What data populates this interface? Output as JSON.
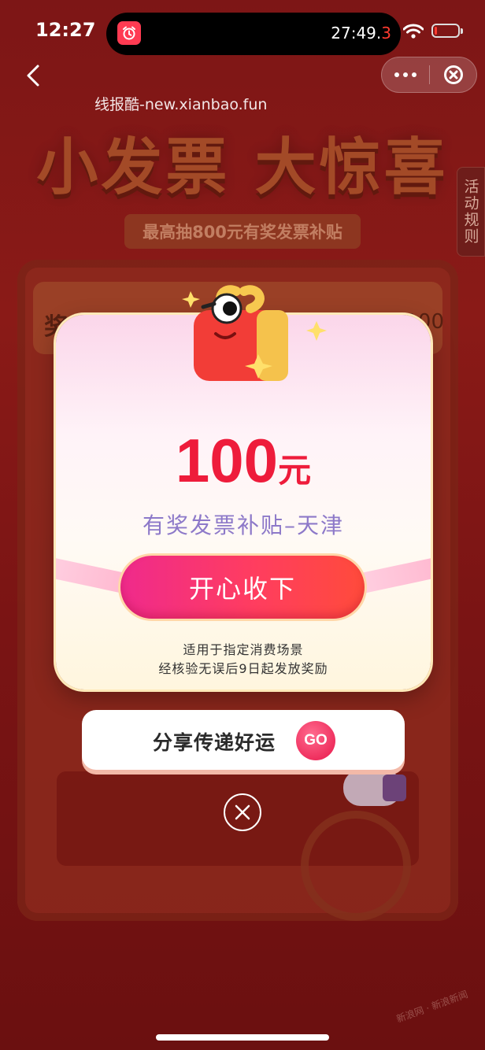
{
  "status_bar": {
    "time": "12:27",
    "timer_main": "27:49.",
    "timer_red": "3",
    "alarm_icon": "alarm-clock-icon",
    "wifi_icon": "wifi-icon",
    "battery_level": 0.12,
    "battery_color": "#ff3b30"
  },
  "nav": {
    "back_icon": "chevron-left-icon",
    "more_icon": "more-dots-icon",
    "close_icon": "close-circle-icon"
  },
  "watermark": "线报酷-new.xianbao.fun",
  "background": {
    "headline": "小发票 大惊喜",
    "subline": "最高抽800元有奖发票补贴",
    "rules_tab": "活动规则",
    "prize_label": "奖品",
    "prize_amount": "¥100"
  },
  "modal": {
    "amount": "100",
    "unit": "元",
    "prize_name": "有奖发票补贴–天津",
    "accept_label": "开心收下",
    "note_line1": "适用于指定消费场景",
    "note_line2": "经核验无误后9日起发放奖励",
    "accent_color": "#ee1c3b"
  },
  "share": {
    "label": "分享传递好运",
    "go": "GO"
  },
  "corner_watermark": "新浪网 · 新浪新闻"
}
